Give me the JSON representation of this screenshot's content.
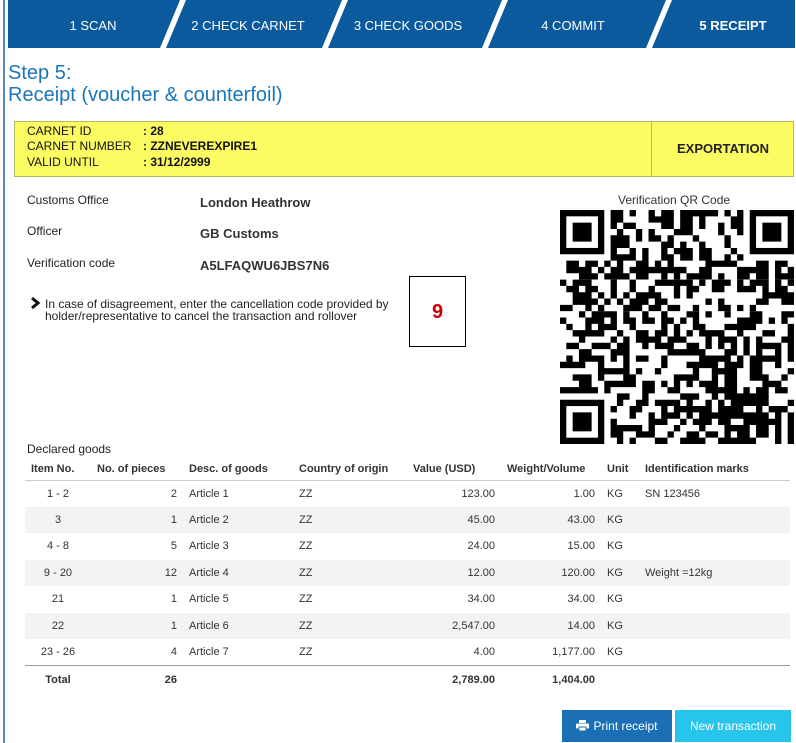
{
  "steps": [
    {
      "label": "1 SCAN"
    },
    {
      "label": "2 CHECK CARNET"
    },
    {
      "label": "3 CHECK GOODS"
    },
    {
      "label": "4 COMMIT"
    },
    {
      "label": "5 RECEIPT"
    }
  ],
  "title": {
    "line1": "Step 5:",
    "line2": "Receipt (voucher & counterfoil)"
  },
  "carnet": {
    "id_label": "CARNET ID",
    "id_value": ": 28",
    "number_label": "CARNET NUMBER",
    "number_value": ": ZZNEVEREXPIRE1",
    "valid_label": "VALID UNTIL",
    "valid_value": ": 31/12/2999",
    "type": "EXPORTATION"
  },
  "info": {
    "office_label": "Customs Office",
    "office_value": "London Heathrow",
    "officer_label": "Officer",
    "officer_value": "GB Customs",
    "code_label": "Verification code",
    "code_value": "A5LFAQWU6JBS7N6"
  },
  "note": "In case of disagreement, enter the cancellation code provided by holder/representative to cancel the transaction and rollover",
  "callout": "9",
  "qr_title": "Verification QR Code",
  "goods": {
    "title": "Declared goods",
    "headers": [
      "Item No.",
      "No. of pieces",
      "Desc. of goods",
      "Country of origin",
      "Value (USD)",
      "Weight/Volume",
      "Unit",
      "Identification marks"
    ],
    "rows": [
      [
        "1 - 2",
        "2",
        "Article 1",
        "ZZ",
        "123.00",
        "1.00",
        "KG",
        "SN 123456"
      ],
      [
        "3",
        "1",
        "Article 2",
        "ZZ",
        "45.00",
        "43.00",
        "KG",
        ""
      ],
      [
        "4 - 8",
        "5",
        "Article 3",
        "ZZ",
        "24.00",
        "15.00",
        "KG",
        ""
      ],
      [
        "9 - 20",
        "12",
        "Article 4",
        "ZZ",
        "12.00",
        "120.00",
        "KG",
        "Weight =12kg"
      ],
      [
        "21",
        "1",
        "Article 5",
        "ZZ",
        "34.00",
        "34.00",
        "KG",
        ""
      ],
      [
        "22",
        "1",
        "Article 6",
        "ZZ",
        "2,547.00",
        "14.00",
        "KG",
        ""
      ],
      [
        "23 - 26",
        "4",
        "Article 7",
        "ZZ",
        "4.00",
        "1,177.00",
        "KG",
        ""
      ]
    ],
    "total": {
      "label": "Total",
      "pieces": "26",
      "value": "2,789.00",
      "weight": "1,404.00"
    }
  },
  "buttons": {
    "print": "Print receipt",
    "new": "New transaction"
  },
  "colors": {
    "step_bg": "#0b5a9e",
    "title": "#1a76b8",
    "carnet_bg": "#fcfc62",
    "print_btn": "#1a6fb5",
    "new_btn": "#27c4ec",
    "callout": "#cc0000"
  }
}
